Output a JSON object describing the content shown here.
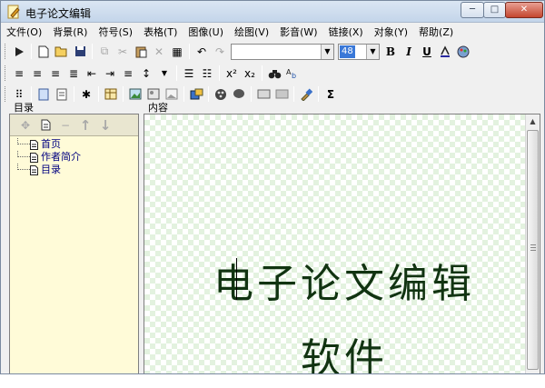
{
  "window": {
    "title": "电子论文编辑",
    "controls": {
      "minimize": "─",
      "maximize": "□",
      "close": "✕"
    }
  },
  "menu": [
    {
      "label": "文件(O)"
    },
    {
      "label": "背景(R)"
    },
    {
      "label": "符号(S)"
    },
    {
      "label": "表格(T)"
    },
    {
      "label": "图像(U)"
    },
    {
      "label": "绘图(V)"
    },
    {
      "label": "影音(W)"
    },
    {
      "label": "链接(X)"
    },
    {
      "label": "对象(Y)"
    },
    {
      "label": "帮助(Z)"
    }
  ],
  "toolbar": {
    "font_name": "",
    "font_size": "48",
    "bold": "B",
    "italic": "I",
    "underline": "U",
    "superscript": "x²",
    "subscript": "x₂",
    "sum": "Σ",
    "asterisk": "✱"
  },
  "panels": {
    "outline_label": "目录",
    "content_label": "内容"
  },
  "tree": [
    {
      "label": "首页"
    },
    {
      "label": "作者简介"
    },
    {
      "label": "目录"
    }
  ],
  "document": {
    "line1": "电子论文编辑",
    "line2": "软件"
  },
  "colors": {
    "accent": "#3a78d8",
    "outline_bg": "#fffbd8",
    "tree_text": "#000080",
    "doc_text": "#113311",
    "checker": "#e3f2df"
  }
}
